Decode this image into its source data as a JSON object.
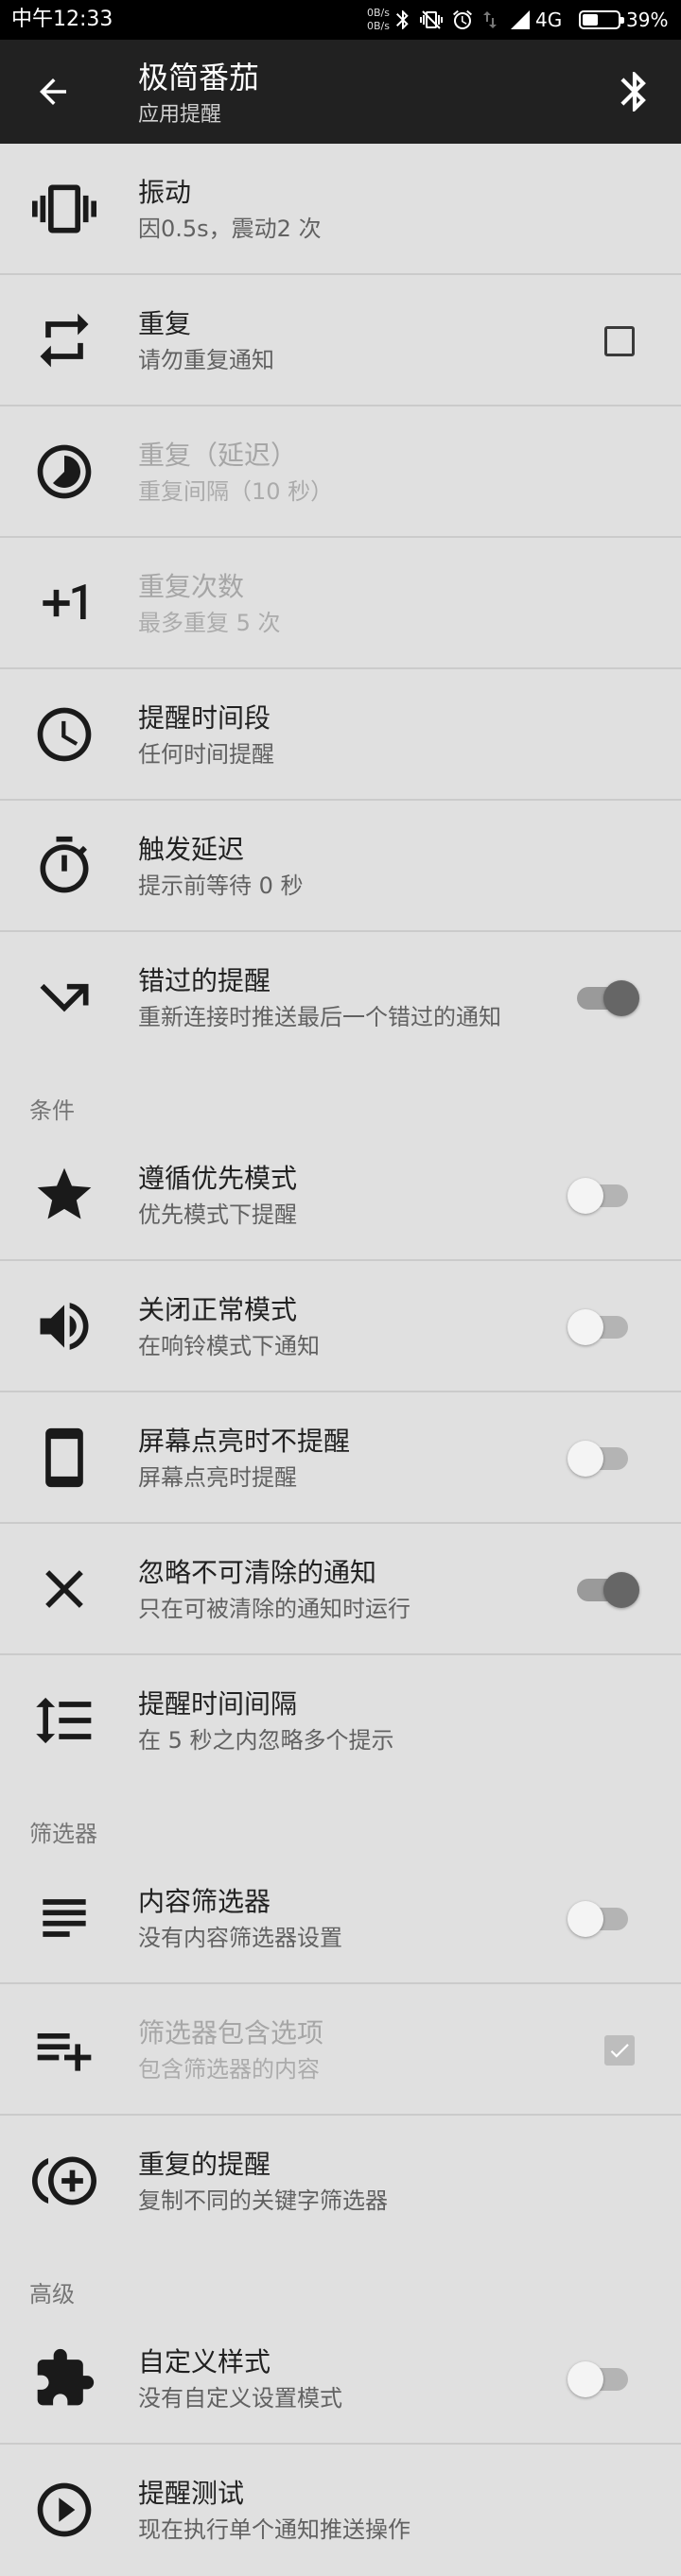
{
  "status_bar": {
    "time": "中午12:33",
    "net_speed": [
      "0B/s",
      "0B/s"
    ],
    "network_type": "4G",
    "battery": "39%",
    "icons": [
      "bluetooth-icon",
      "vibrate-mode-icon",
      "alarm-icon",
      "data-activity-icon",
      "signal-icon",
      "battery-icon"
    ]
  },
  "app_bar": {
    "title": "极简番茄",
    "subtitle": "应用提醒",
    "back_icon": "arrow-back-icon",
    "action_icon": "bluetooth-icon"
  },
  "colors": {
    "status_bar": "#000000",
    "app_bar": "#212121",
    "background": "#e0e0e0",
    "text_primary": "#212121",
    "text_secondary": "#616161",
    "text_disabled": "#a6a6a6",
    "switch_on_thumb": "#666666"
  },
  "sections": [
    {
      "items": [
        {
          "icon": "vibration-icon",
          "title": "振动",
          "summary": "因0.5s，震动2 次",
          "disabled": false
        },
        {
          "icon": "repeat-icon",
          "title": "重复",
          "summary": "请勿重复通知",
          "disabled": false,
          "checked": false
        },
        {
          "icon": "timelapse-icon",
          "title": "重复（延迟）",
          "summary": "重复间隔（10 秒）",
          "disabled": true
        },
        {
          "icon": "plus-one-icon",
          "title": "重复次数",
          "summary": "最多重复 5 次",
          "disabled": true
        },
        {
          "icon": "clock-icon",
          "title": "提醒时间段",
          "summary": "任何时间提醒",
          "disabled": false
        },
        {
          "icon": "timer-icon",
          "title": "触发延迟",
          "summary": "提示前等待 0 秒",
          "disabled": false
        },
        {
          "icon": "missed-outgoing-icon",
          "title": "错过的提醒",
          "summary": "重新连接时推送最后一个错过的通知",
          "disabled": false,
          "switch_on": true
        }
      ]
    },
    {
      "header": "条件",
      "items": [
        {
          "icon": "star-icon",
          "title": "遵循优先模式",
          "summary": "优先模式下提醒",
          "disabled": false,
          "switch_on": false
        },
        {
          "icon": "volume-up-icon",
          "title": "关闭正常模式",
          "summary": "在响铃模式下通知",
          "disabled": false,
          "switch_on": false
        },
        {
          "icon": "smartphone-icon",
          "title": "屏幕点亮时不提醒",
          "summary": "屏幕点亮时提醒",
          "disabled": false,
          "switch_on": false
        },
        {
          "icon": "close-icon",
          "title": "忽略不可清除的通知",
          "summary": "只在可被清除的通知时运行",
          "disabled": false,
          "switch_on": true
        },
        {
          "icon": "line-spacing-icon",
          "title": "提醒时间间隔",
          "summary": "在 5 秒之内忽略多个提示",
          "disabled": false
        }
      ]
    },
    {
      "header": "筛选器",
      "items": [
        {
          "icon": "subject-icon",
          "title": "内容筛选器",
          "summary": "没有内容筛选器设置",
          "disabled": false,
          "switch_on": false
        },
        {
          "icon": "playlist-add-icon",
          "title": "筛选器包含选项",
          "summary": "包含筛选器的内容",
          "disabled": true,
          "checked": true
        },
        {
          "icon": "duplicate-add-icon",
          "title": "重复的提醒",
          "summary": "复制不同的关键字筛选器",
          "disabled": false
        }
      ]
    },
    {
      "header": "高级",
      "items": [
        {
          "icon": "extension-icon",
          "title": "自定义样式",
          "summary": "没有自定义设置模式",
          "disabled": false,
          "switch_on": false
        },
        {
          "icon": "play-circle-icon",
          "title": "提醒测试",
          "summary": "现在执行单个通知推送操作",
          "disabled": false
        }
      ]
    }
  ]
}
